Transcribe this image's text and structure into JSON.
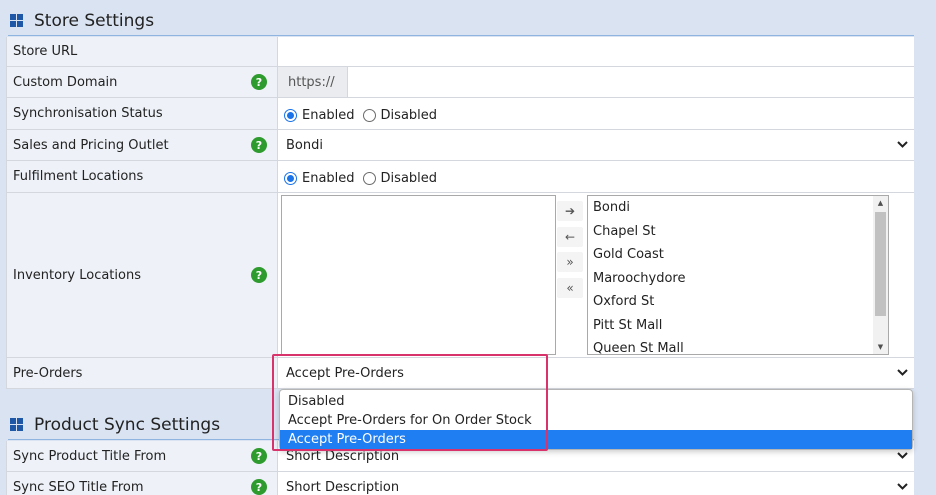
{
  "store_settings": {
    "title": "Store Settings",
    "rows": {
      "store_url": {
        "label": "Store URL",
        "value": ""
      },
      "custom_domain": {
        "label": "Custom Domain",
        "prefix": "https://",
        "value": ""
      },
      "sync_status": {
        "label": "Synchronisation Status",
        "enabled_label": "Enabled",
        "disabled_label": "Disabled",
        "selected": "Enabled"
      },
      "sales_outlet": {
        "label": "Sales and Pricing Outlet",
        "value": "Bondi"
      },
      "fulfilment": {
        "label": "Fulfilment Locations",
        "enabled_label": "Enabled",
        "disabled_label": "Disabled",
        "selected": "Enabled"
      },
      "inventory": {
        "label": "Inventory Locations",
        "available": [
          "Bondi",
          "Chapel St",
          "Gold Coast",
          "Maroochydore",
          "Oxford St",
          "Pitt St Mall",
          "Queen St Mall"
        ],
        "buttons": {
          "move_right": "➔",
          "move_left": "←",
          "move_all_right": "»",
          "move_all_left": "«"
        }
      },
      "pre_orders": {
        "label": "Pre-Orders",
        "value": "Accept Pre-Orders",
        "options": [
          "Disabled",
          "Accept Pre-Orders for On Order Stock",
          "Accept Pre-Orders"
        ],
        "selected_index": 2
      }
    }
  },
  "product_sync_settings": {
    "title": "Product Sync Settings",
    "rows": {
      "sync_title": {
        "label": "Sync Product Title From",
        "value": "Short Description"
      },
      "sync_seo": {
        "label": "Sync SEO Title From",
        "value": "Short Description"
      }
    }
  },
  "icons": {
    "help": "?",
    "grid": "grid-icon"
  },
  "colors": {
    "accent": "#1a73e8",
    "help_green": "#2e9b2e",
    "highlight": "#d8336b",
    "selected_option": "#1f7ef2"
  }
}
